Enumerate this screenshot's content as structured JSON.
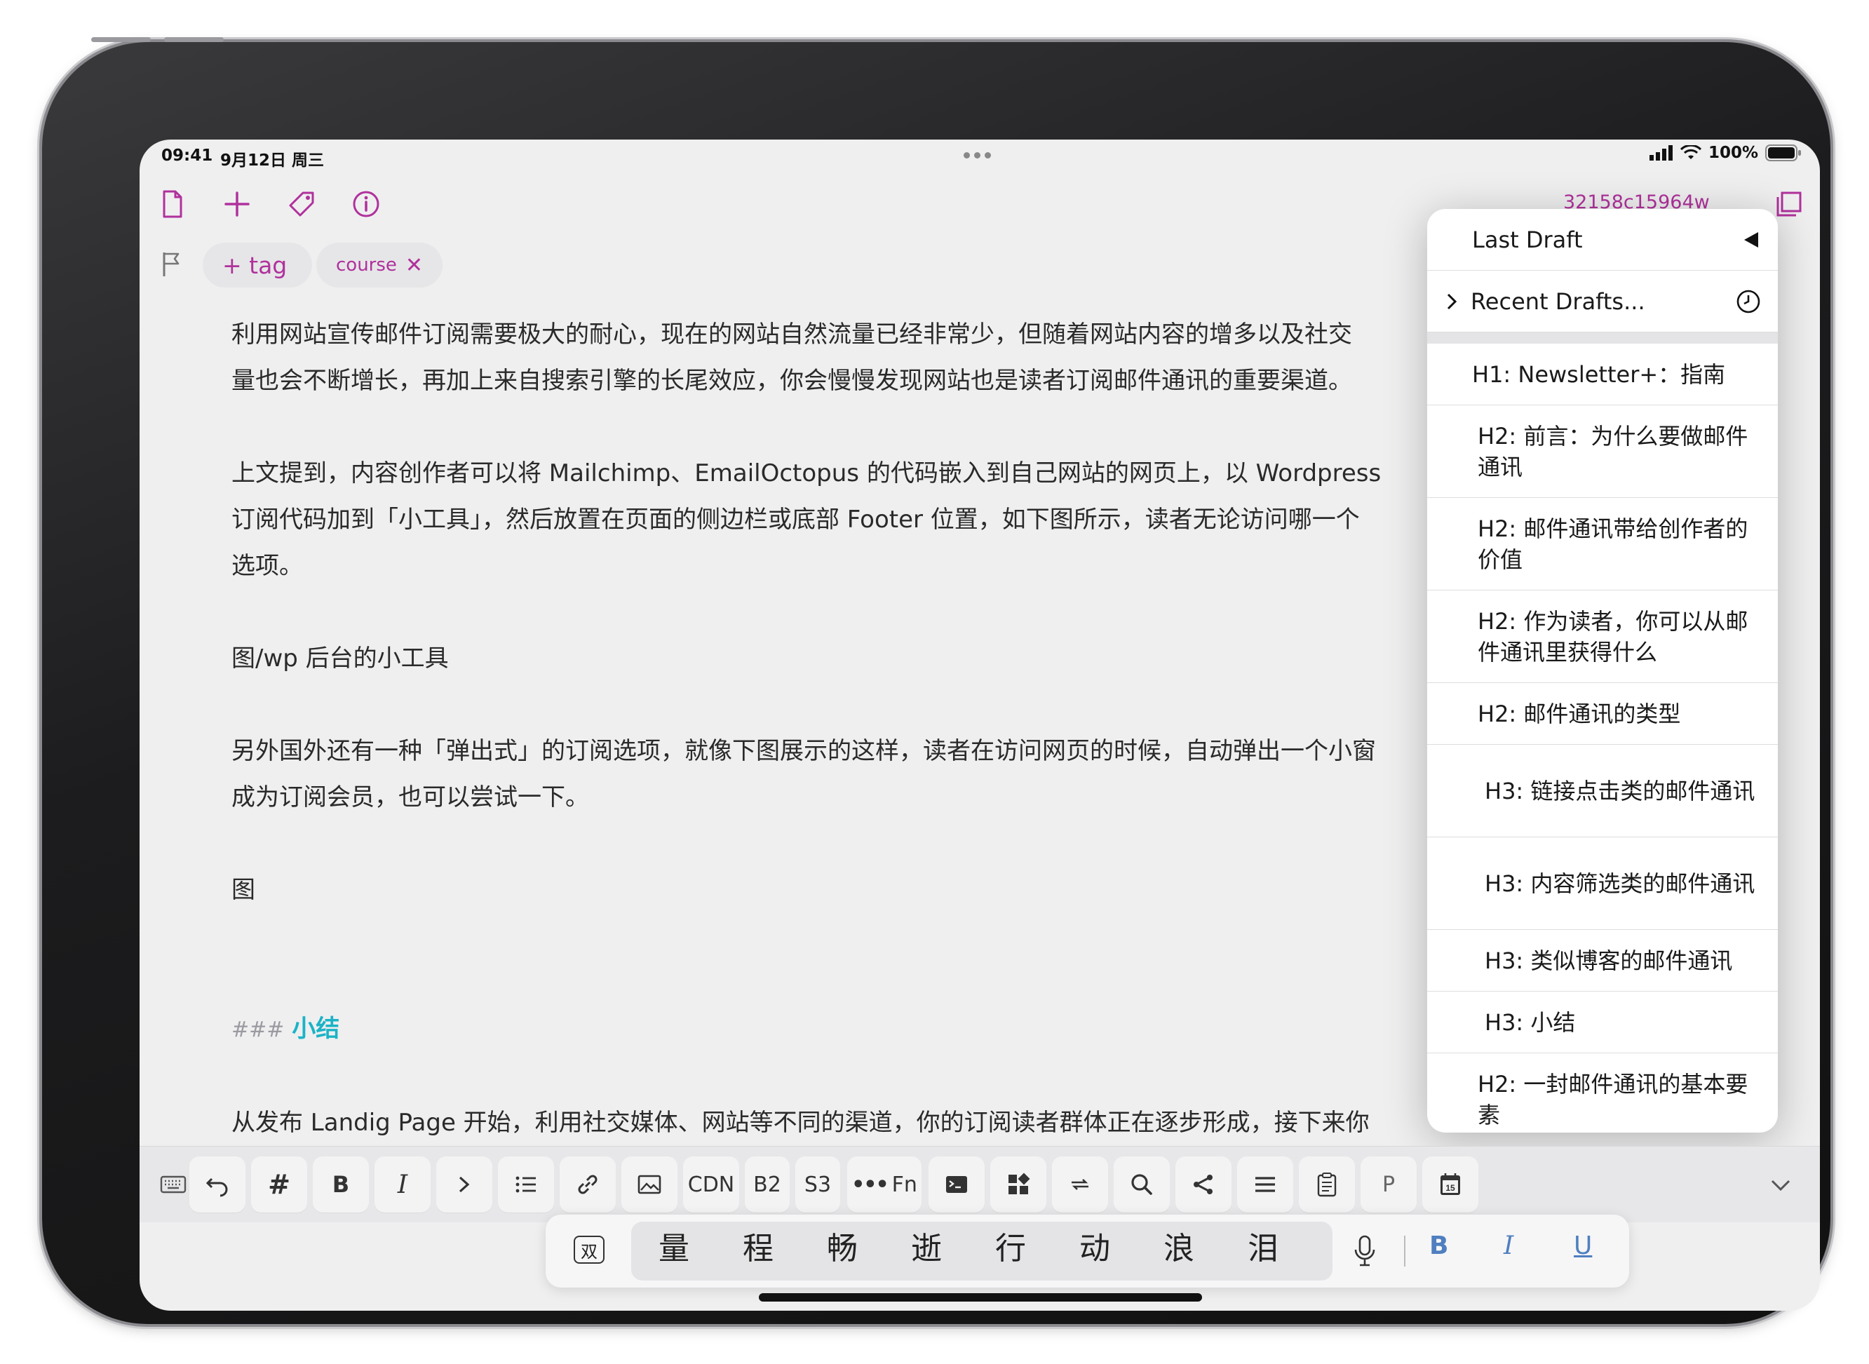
{
  "status": {
    "time": "09:41",
    "date": "9月12日 周三",
    "battery": "100%"
  },
  "toolbar": {
    "draft_id": "32158c15964w"
  },
  "tags": {
    "add_label": "+ tag",
    "course_label": "course"
  },
  "editor": {
    "paragraphs": [
      "利用网站宣传邮件订阅需要极大的耐心，现在的网站自然流量已经非常少，但随着网站内容的增多以及社交",
      "量也会不断增长，再加上来自搜索引擎的长尾效应，你会慢慢发现网站也是读者订阅邮件通讯的重要渠道。",
      "上文提到，内容创作者可以将 Mailchimp、EmailOctopus 的代码嵌入到自己网站的网页上，以 Wordpress",
      "订阅代码加到「小工具」，然后放置在页面的侧边栏或底部 Footer 位置，如下图所示，读者无论访问哪一个",
      "选项。",
      "图/wp 后台的小工具",
      "另外国外还有一种「弹出式」的订阅选项，就像下图展示的这样，读者在访问网页的时候，自动弹出一个小窗",
      "成为订阅会员，也可以尝试一下。",
      "图",
      "从发布 Landig Page 开始，利用社交媒体、网站等不同的渠道，你的订阅读者群体正在逐步形成，接下来你"
    ],
    "heading_marker": "###",
    "heading_text": "小结"
  },
  "popover": {
    "last_draft": "Last Draft",
    "recent_drafts": "Recent Drafts...",
    "outline": [
      "H1: Newsletter+：指南",
      "H2: 前言：为什么要做邮件通讯",
      "H2: 邮件通讯带给创作者的价值",
      "H2: 作为读者，你可以从邮件通讯里获得什么",
      "H2: 邮件通讯的类型",
      "H3: 链接点击类的邮件通讯",
      "H3: 内容筛选类的邮件通讯",
      "H3: 类似博客的邮件通讯",
      "H3: 小结",
      "H2: 一封邮件通讯的基本要素"
    ]
  },
  "keys": {
    "cdn": "CDN",
    "b2": "B2",
    "s3": "S3",
    "fn": "Fn",
    "p": "P",
    "calendar_day": "15"
  },
  "candidates": {
    "ime_label": "双",
    "items": [
      "量",
      "程",
      "畅",
      "逝",
      "行",
      "动",
      "浪",
      "泪"
    ],
    "bold": "B",
    "italic": "I",
    "underline": "U"
  },
  "colors": {
    "accent": "#b0319c",
    "heading": "#1bb3c6"
  }
}
